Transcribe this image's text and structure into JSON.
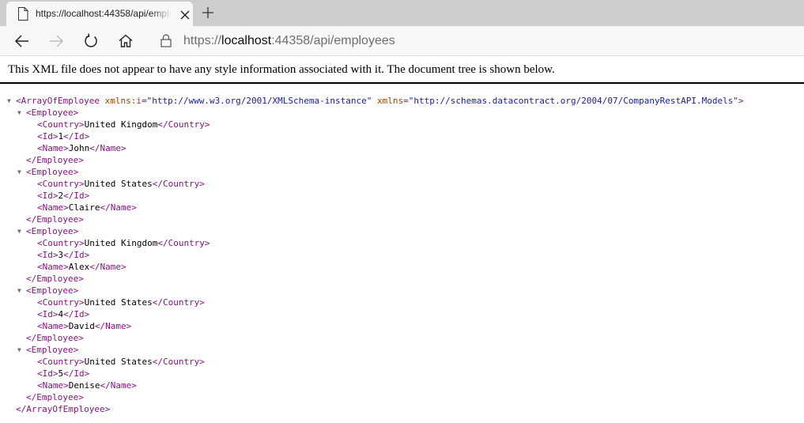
{
  "browser": {
    "tab_title": "https://localhost:44358/api/employees",
    "url_prefix": "https://",
    "url_host": "localhost",
    "url_rest": ":44358/api/employees",
    "icons": [
      "page-icon",
      "close-icon",
      "new-tab-icon",
      "back-icon",
      "forward-icon",
      "refresh-icon",
      "home-icon",
      "lock-icon"
    ]
  },
  "page": {
    "header_text": "This XML file does not appear to have any style information associated with it. The document tree is shown below."
  },
  "xml": {
    "root_tag": "ArrayOfEmployee",
    "root_open_tag_name": "<ArrayOfEmployee",
    "attr1_name": "xmlns:i",
    "attr1_value": "\"http://www.w3.org/2001/XMLSchema-instance\"",
    "attr2_name": "xmlns",
    "attr2_value": "\"http://schemas.datacontract.org/2004/07/CompanyRestAPI.Models\"",
    "root_open_end": ">",
    "root_close": "</ArrayOfEmployee>",
    "employee_open": "<Employee>",
    "employee_close": "</Employee>",
    "country_open": "<Country>",
    "country_close": "</Country>",
    "id_open": "<Id>",
    "id_close": "</Id>",
    "name_open": "<Name>",
    "name_close": "</Name>",
    "employees": [
      {
        "country": "United Kingdom",
        "id": "1",
        "name": "John"
      },
      {
        "country": "United States",
        "id": "2",
        "name": "Claire"
      },
      {
        "country": "United Kingdom",
        "id": "3",
        "name": "Alex"
      },
      {
        "country": "United States",
        "id": "4",
        "name": "David"
      },
      {
        "country": "United States",
        "id": "5",
        "name": "Denise"
      }
    ]
  }
}
